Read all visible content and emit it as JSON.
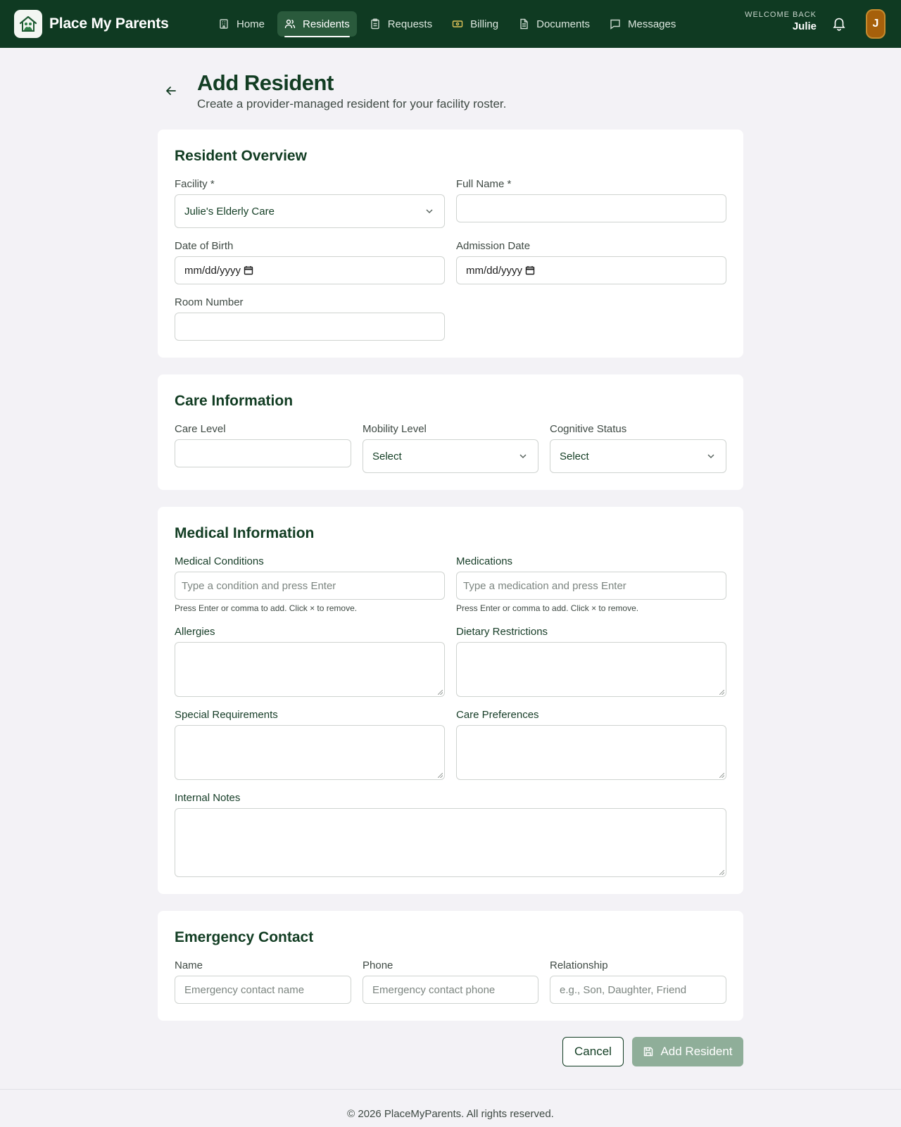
{
  "app": {
    "brand_name": "Place My Parents"
  },
  "nav": {
    "items": [
      {
        "label": "Home",
        "icon": "building-icon"
      },
      {
        "label": "Residents",
        "icon": "users-icon",
        "active": true
      },
      {
        "label": "Requests",
        "icon": "clipboard-icon"
      },
      {
        "label": "Billing",
        "icon": "banknote-icon"
      },
      {
        "label": "Documents",
        "icon": "document-icon"
      },
      {
        "label": "Messages",
        "icon": "message-icon"
      }
    ],
    "welcome_label": "WELCOME BACK",
    "user_name": "Julie",
    "avatar_initial": "J"
  },
  "header": {
    "title": "Add Resident",
    "subtitle": "Create a provider-managed resident for your facility roster."
  },
  "overview": {
    "title": "Resident Overview",
    "facility_label": "Facility *",
    "facility_value": "Julie's Elderly Care",
    "full_name_label": "Full Name *",
    "full_name_value": "",
    "dob_label": "Date of Birth",
    "dob_value": "mm/dd/yyyy",
    "admission_label": "Admission Date",
    "admission_value": "mm/dd/yyyy",
    "room_label": "Room Number",
    "room_value": ""
  },
  "care": {
    "title": "Care Information",
    "care_level_label": "Care Level",
    "care_level_value": "",
    "mobility_label": "Mobility Level",
    "mobility_value": "Select",
    "cognitive_label": "Cognitive Status",
    "cognitive_value": "Select"
  },
  "medical": {
    "title": "Medical Information",
    "conditions_label": "Medical Conditions",
    "conditions_placeholder": "Type a condition and press Enter",
    "conditions_hint": "Press Enter or comma to add. Click × to remove.",
    "medications_label": "Medications",
    "medications_placeholder": "Type a medication and press Enter",
    "medications_hint": "Press Enter or comma to add. Click × to remove.",
    "allergies_label": "Allergies",
    "dietary_label": "Dietary Restrictions",
    "special_label": "Special Requirements",
    "preferences_label": "Care Preferences",
    "notes_label": "Internal Notes"
  },
  "emergency": {
    "title": "Emergency Contact",
    "name_label": "Name",
    "name_placeholder": "Emergency contact name",
    "phone_label": "Phone",
    "phone_placeholder": "Emergency contact phone",
    "relationship_label": "Relationship",
    "relationship_placeholder": "e.g., Son, Daughter, Friend"
  },
  "actions": {
    "cancel_label": "Cancel",
    "add_label": "Add Resident"
  },
  "footer": {
    "text": "© 2026 PlaceMyParents. All rights reserved."
  },
  "colors": {
    "nav_bg": "#0f3a22",
    "accent": "#123d23",
    "page_bg": "#f3f2f6",
    "add_button_bg": "#8fae99",
    "avatar_bg": "#a6600b"
  }
}
